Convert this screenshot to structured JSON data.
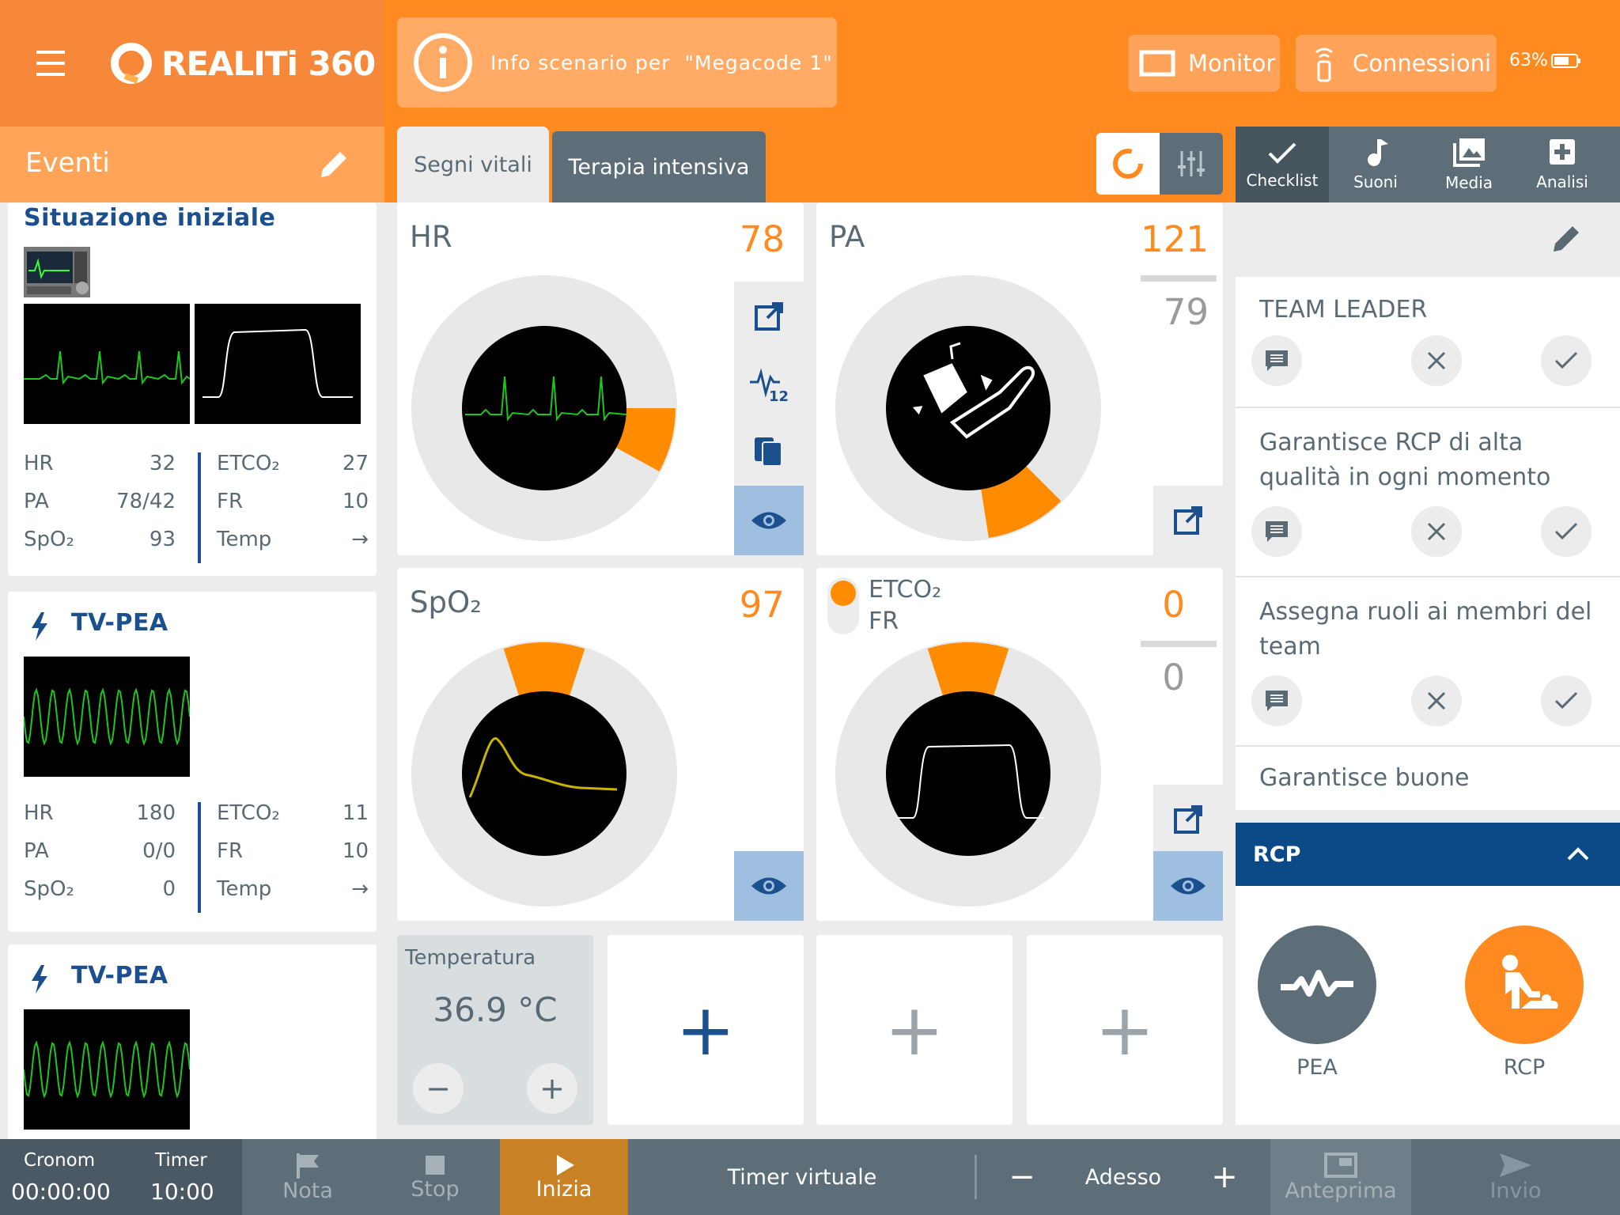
{
  "header": {
    "logo_text": "REALITi 360",
    "scenario_text": "Info scenario per  \"Megacode 1\"",
    "monitor_label": "Monitor",
    "connections_label": "Connessioni",
    "battery": "63%",
    "brand_color": "#ff8a1f"
  },
  "events": {
    "title": "Eventi",
    "cards": [
      {
        "title": "Situazione iniziale",
        "stats_left": [
          {
            "label": "HR",
            "value": "32"
          },
          {
            "label": "PA",
            "value": "78/42"
          },
          {
            "label": "SpO₂",
            "value": "93"
          }
        ],
        "stats_right": [
          {
            "label": "ETCO₂",
            "value": "27"
          },
          {
            "label": "FR",
            "value": "10"
          },
          {
            "label": "Temp",
            "value": "→"
          }
        ]
      },
      {
        "title": "TV-PEA",
        "stats_left": [
          {
            "label": "HR",
            "value": "180"
          },
          {
            "label": "PA",
            "value": "0/0"
          },
          {
            "label": "SpO₂",
            "value": "0"
          }
        ],
        "stats_right": [
          {
            "label": "ETCO₂",
            "value": "11"
          },
          {
            "label": "FR",
            "value": "10"
          },
          {
            "label": "Temp",
            "value": "→"
          }
        ]
      },
      {
        "title": "TV-PEA"
      }
    ]
  },
  "tabs": {
    "vitals": "Segni vitali",
    "intensive": "Terapia intensiva"
  },
  "right_tabs": [
    {
      "label": "Checklist",
      "icon": "check-icon"
    },
    {
      "label": "Suoni",
      "icon": "music-note-icon"
    },
    {
      "label": "Media",
      "icon": "image-icon"
    },
    {
      "label": "Analisi",
      "icon": "plus-box-icon"
    }
  ],
  "vitals": {
    "hr": {
      "label": "HR",
      "value": "78",
      "ring_level": 0.08
    },
    "pa": {
      "label": "PA",
      "systolic": "121",
      "diastolic": "79",
      "ring_level": 0.1
    },
    "spo2": {
      "label": "SpO₂",
      "value": "97",
      "ring_level": 0.1
    },
    "etco2": {
      "label1": "ETCO₂",
      "label2": "FR",
      "value1": "0",
      "value2": "0",
      "ring_level": 0.1
    },
    "temp": {
      "label": "Temperatura",
      "value": "36.9 °C",
      "minus": "−",
      "plus": "+"
    }
  },
  "add_tile": "+",
  "checklist": {
    "items": [
      {
        "text": "TEAM LEADER"
      },
      {
        "text": "Garantisce RCP di alta qualità in ogni momento"
      },
      {
        "text": "Assegna ruoli ai membri del team"
      },
      {
        "text": "Garantisce buone"
      }
    ]
  },
  "rcp": {
    "title": "RCP",
    "actions": [
      {
        "label": "PEA",
        "color": "#5d6e79"
      },
      {
        "label": "RCP",
        "color": "#ff8a1f"
      }
    ]
  },
  "footer": {
    "cronom_label": "Cronom",
    "cronom_value": "00:00:00",
    "timer_label": "Timer",
    "timer_value": "10:00",
    "note": "Nota",
    "stop": "Stop",
    "start": "Inizia",
    "virtual_timer": "Timer virtuale",
    "minus": "−",
    "now": "Adesso",
    "plus": "+",
    "preview": "Anteprima",
    "send": "Invio"
  }
}
